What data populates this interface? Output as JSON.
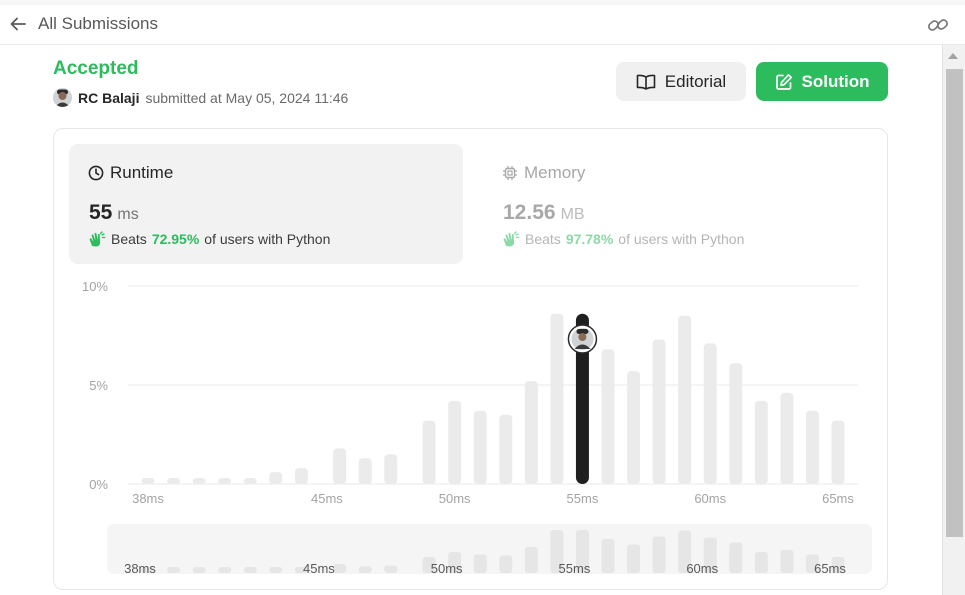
{
  "nav": {
    "back_label": "All Submissions"
  },
  "submission": {
    "status": "Accepted",
    "author": "RC Balaji",
    "submitted_text": "submitted at May 05, 2024 11:46"
  },
  "actions": {
    "editorial_label": "Editorial",
    "solution_label": "Solution"
  },
  "runtime": {
    "label": "Runtime",
    "value": "55",
    "unit": "ms",
    "beats_prefix": "Beats",
    "beats_pct": "72.95%",
    "beats_suffix": "of users with Python"
  },
  "memory": {
    "label": "Memory",
    "value": "12.56",
    "unit": "MB",
    "beats_prefix": "Beats",
    "beats_pct": "97.78%",
    "beats_suffix": "of users with Python"
  },
  "colors": {
    "accent": "#2cbb5d",
    "bar": "#ebebeb",
    "bar_selected": "#1f1f1f"
  },
  "icons": {
    "back": "arrow-left-icon",
    "link": "link-icon",
    "editorial": "book-open-icon",
    "solution": "edit-icon",
    "runtime": "clock-icon",
    "memory": "chip-icon",
    "beats": "clap-icon"
  },
  "chart_data": {
    "type": "bar",
    "xlabel": "",
    "ylabel": "",
    "x_tick_labels": [
      "38ms",
      "45ms",
      "50ms",
      "55ms",
      "60ms",
      "65ms"
    ],
    "x_tick_values": [
      38,
      45,
      50,
      55,
      60,
      65
    ],
    "y_tick_labels": [
      "10%",
      "5%",
      "0%"
    ],
    "y_tick_values": [
      10,
      5,
      0
    ],
    "ylim": [
      0,
      10
    ],
    "grid": true,
    "selected_x": 55,
    "x": [
      38,
      39,
      40,
      41,
      42,
      43,
      44,
      45.5,
      46.5,
      47.5,
      49,
      50,
      51,
      52,
      53,
      54,
      55,
      56,
      57,
      58,
      59,
      60,
      61,
      62,
      63,
      64,
      65
    ],
    "values": [
      0.3,
      0.3,
      0.3,
      0.3,
      0.3,
      0.6,
      0.8,
      1.8,
      1.3,
      1.5,
      3.2,
      4.2,
      3.7,
      3.5,
      5.2,
      8.6,
      8.6,
      6.8,
      5.7,
      7.3,
      8.5,
      7.1,
      6.1,
      4.2,
      4.6,
      3.7,
      3.2
    ],
    "overview_tick_labels": [
      "38ms",
      "45ms",
      "50ms",
      "55ms",
      "60ms",
      "65ms"
    ]
  }
}
